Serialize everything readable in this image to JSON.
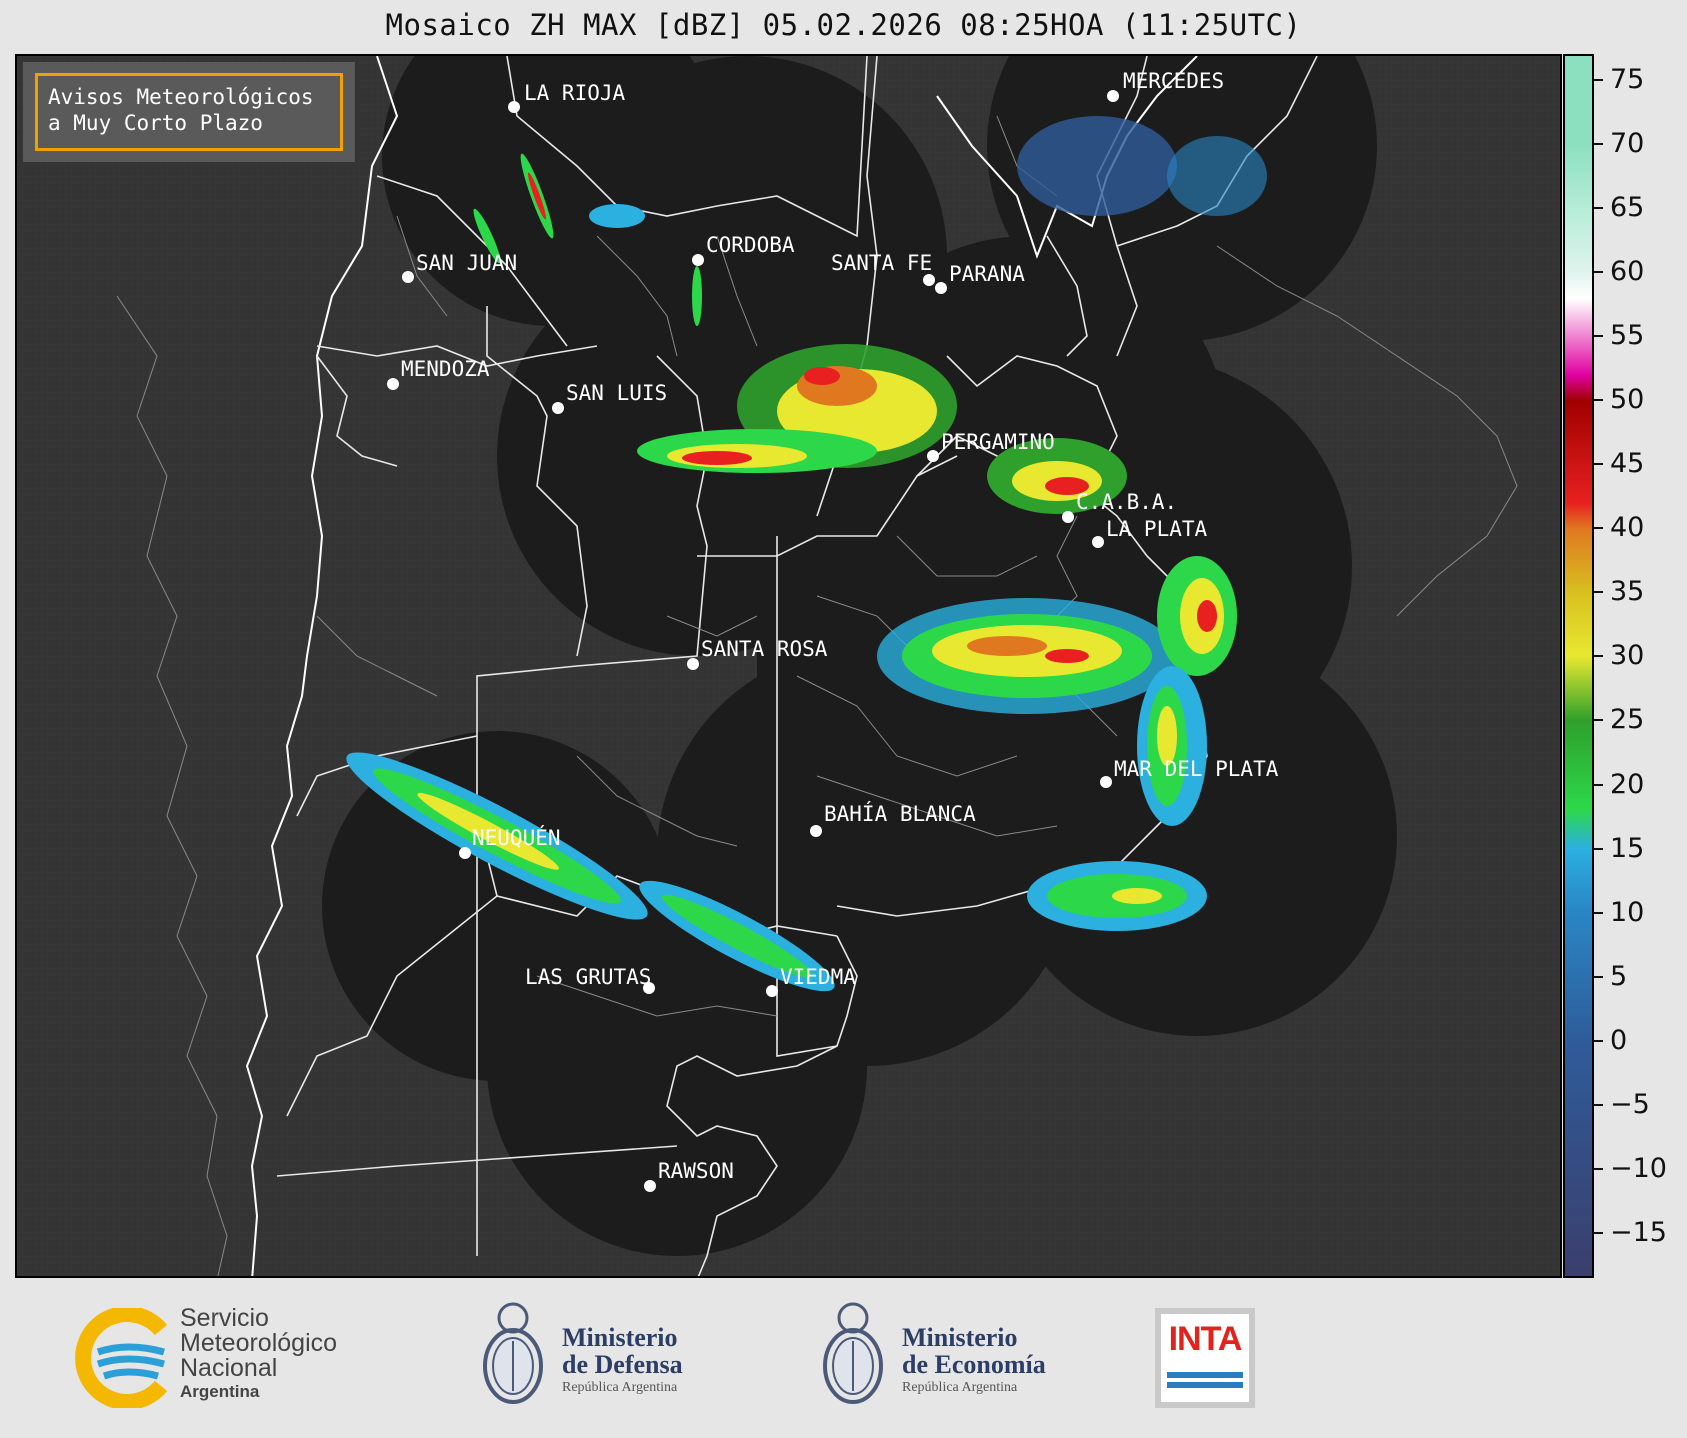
{
  "title": "Mosaico ZH MAX [dBZ] 05.02.2026 08:25HOA (11:25UTC)",
  "notice": {
    "line1": "Avisos Meteorológicos",
    "line2": "a Muy Corto Plazo"
  },
  "cities": [
    {
      "name": "LA RIOJA"
    },
    {
      "name": "MERCEDES"
    },
    {
      "name": "CORDOBA"
    },
    {
      "name": "SAN JUAN"
    },
    {
      "name": "SANTA FE"
    },
    {
      "name": "PARANA"
    },
    {
      "name": "MENDOZA"
    },
    {
      "name": "SAN LUIS"
    },
    {
      "name": "PERGAMINO"
    },
    {
      "name": "C.A.B.A."
    },
    {
      "name": "LA PLATA"
    },
    {
      "name": "SANTA ROSA"
    },
    {
      "name": "MAR DEL PLATA"
    },
    {
      "name": "BAHÍA BLANCA"
    },
    {
      "name": "NEUQUÉN"
    },
    {
      "name": "LAS GRUTAS"
    },
    {
      "name": "VIEDMA"
    },
    {
      "name": "RAWSON"
    }
  ],
  "colorbar": {
    "min": -18.5,
    "max": 77,
    "ticks": [
      "75",
      "70",
      "65",
      "60",
      "55",
      "50",
      "45",
      "40",
      "35",
      "30",
      "25",
      "20",
      "15",
      "10",
      "5",
      "0",
      "−5",
      "−10",
      "−15"
    ],
    "colors": {
      "-18": "#3a3f6e",
      "0": "#2f5c9a",
      "10": "#2a86c4",
      "15": "#2bb0e0",
      "18": "#2cd84a",
      "25": "#2fa02c",
      "30": "#e8e830",
      "35": "#d8c020",
      "40": "#e07820",
      "42": "#e82020",
      "50": "#a00000",
      "52": "#e000a0",
      "58": "#ffffff",
      "60": "#e0f4ee",
      "65": "#b6ecd8",
      "70": "#8ce0c0"
    }
  },
  "logos": {
    "smn": {
      "line1": "Servicio",
      "line2": "Meteorológico",
      "line3": "Nacional",
      "line4": "Argentina"
    },
    "defensa": {
      "line1": "Ministerio",
      "line2": "de Defensa",
      "line3": "República Argentina"
    },
    "economia": {
      "line1": "Ministerio",
      "line2": "de Economía",
      "line3": "República Argentina"
    },
    "inta": {
      "text": "INTA"
    }
  }
}
